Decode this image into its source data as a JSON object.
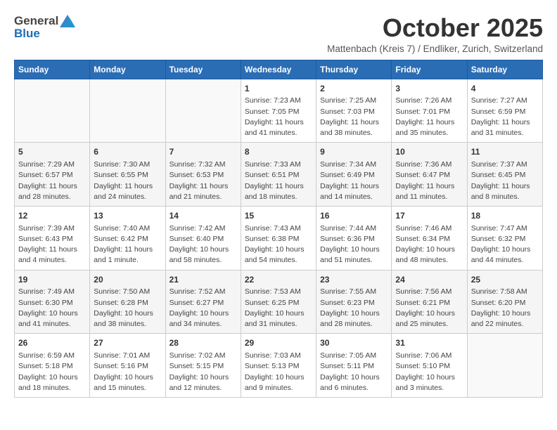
{
  "header": {
    "logo_general": "General",
    "logo_blue": "Blue",
    "month_title": "October 2025",
    "subtitle": "Mattenbach (Kreis 7) / Endliker, Zurich, Switzerland"
  },
  "days_of_week": [
    "Sunday",
    "Monday",
    "Tuesday",
    "Wednesday",
    "Thursday",
    "Friday",
    "Saturday"
  ],
  "weeks": [
    {
      "days": [
        {
          "number": "",
          "info": ""
        },
        {
          "number": "",
          "info": ""
        },
        {
          "number": "",
          "info": ""
        },
        {
          "number": "1",
          "info": "Sunrise: 7:23 AM\nSunset: 7:05 PM\nDaylight: 11 hours\nand 41 minutes."
        },
        {
          "number": "2",
          "info": "Sunrise: 7:25 AM\nSunset: 7:03 PM\nDaylight: 11 hours\nand 38 minutes."
        },
        {
          "number": "3",
          "info": "Sunrise: 7:26 AM\nSunset: 7:01 PM\nDaylight: 11 hours\nand 35 minutes."
        },
        {
          "number": "4",
          "info": "Sunrise: 7:27 AM\nSunset: 6:59 PM\nDaylight: 11 hours\nand 31 minutes."
        }
      ]
    },
    {
      "days": [
        {
          "number": "5",
          "info": "Sunrise: 7:29 AM\nSunset: 6:57 PM\nDaylight: 11 hours\nand 28 minutes."
        },
        {
          "number": "6",
          "info": "Sunrise: 7:30 AM\nSunset: 6:55 PM\nDaylight: 11 hours\nand 24 minutes."
        },
        {
          "number": "7",
          "info": "Sunrise: 7:32 AM\nSunset: 6:53 PM\nDaylight: 11 hours\nand 21 minutes."
        },
        {
          "number": "8",
          "info": "Sunrise: 7:33 AM\nSunset: 6:51 PM\nDaylight: 11 hours\nand 18 minutes."
        },
        {
          "number": "9",
          "info": "Sunrise: 7:34 AM\nSunset: 6:49 PM\nDaylight: 11 hours\nand 14 minutes."
        },
        {
          "number": "10",
          "info": "Sunrise: 7:36 AM\nSunset: 6:47 PM\nDaylight: 11 hours\nand 11 minutes."
        },
        {
          "number": "11",
          "info": "Sunrise: 7:37 AM\nSunset: 6:45 PM\nDaylight: 11 hours\nand 8 minutes."
        }
      ]
    },
    {
      "days": [
        {
          "number": "12",
          "info": "Sunrise: 7:39 AM\nSunset: 6:43 PM\nDaylight: 11 hours\nand 4 minutes."
        },
        {
          "number": "13",
          "info": "Sunrise: 7:40 AM\nSunset: 6:42 PM\nDaylight: 11 hours\nand 1 minute."
        },
        {
          "number": "14",
          "info": "Sunrise: 7:42 AM\nSunset: 6:40 PM\nDaylight: 10 hours\nand 58 minutes."
        },
        {
          "number": "15",
          "info": "Sunrise: 7:43 AM\nSunset: 6:38 PM\nDaylight: 10 hours\nand 54 minutes."
        },
        {
          "number": "16",
          "info": "Sunrise: 7:44 AM\nSunset: 6:36 PM\nDaylight: 10 hours\nand 51 minutes."
        },
        {
          "number": "17",
          "info": "Sunrise: 7:46 AM\nSunset: 6:34 PM\nDaylight: 10 hours\nand 48 minutes."
        },
        {
          "number": "18",
          "info": "Sunrise: 7:47 AM\nSunset: 6:32 PM\nDaylight: 10 hours\nand 44 minutes."
        }
      ]
    },
    {
      "days": [
        {
          "number": "19",
          "info": "Sunrise: 7:49 AM\nSunset: 6:30 PM\nDaylight: 10 hours\nand 41 minutes."
        },
        {
          "number": "20",
          "info": "Sunrise: 7:50 AM\nSunset: 6:28 PM\nDaylight: 10 hours\nand 38 minutes."
        },
        {
          "number": "21",
          "info": "Sunrise: 7:52 AM\nSunset: 6:27 PM\nDaylight: 10 hours\nand 34 minutes."
        },
        {
          "number": "22",
          "info": "Sunrise: 7:53 AM\nSunset: 6:25 PM\nDaylight: 10 hours\nand 31 minutes."
        },
        {
          "number": "23",
          "info": "Sunrise: 7:55 AM\nSunset: 6:23 PM\nDaylight: 10 hours\nand 28 minutes."
        },
        {
          "number": "24",
          "info": "Sunrise: 7:56 AM\nSunset: 6:21 PM\nDaylight: 10 hours\nand 25 minutes."
        },
        {
          "number": "25",
          "info": "Sunrise: 7:58 AM\nSunset: 6:20 PM\nDaylight: 10 hours\nand 22 minutes."
        }
      ]
    },
    {
      "days": [
        {
          "number": "26",
          "info": "Sunrise: 6:59 AM\nSunset: 5:18 PM\nDaylight: 10 hours\nand 18 minutes."
        },
        {
          "number": "27",
          "info": "Sunrise: 7:01 AM\nSunset: 5:16 PM\nDaylight: 10 hours\nand 15 minutes."
        },
        {
          "number": "28",
          "info": "Sunrise: 7:02 AM\nSunset: 5:15 PM\nDaylight: 10 hours\nand 12 minutes."
        },
        {
          "number": "29",
          "info": "Sunrise: 7:03 AM\nSunset: 5:13 PM\nDaylight: 10 hours\nand 9 minutes."
        },
        {
          "number": "30",
          "info": "Sunrise: 7:05 AM\nSunset: 5:11 PM\nDaylight: 10 hours\nand 6 minutes."
        },
        {
          "number": "31",
          "info": "Sunrise: 7:06 AM\nSunset: 5:10 PM\nDaylight: 10 hours\nand 3 minutes."
        },
        {
          "number": "",
          "info": ""
        }
      ]
    }
  ]
}
